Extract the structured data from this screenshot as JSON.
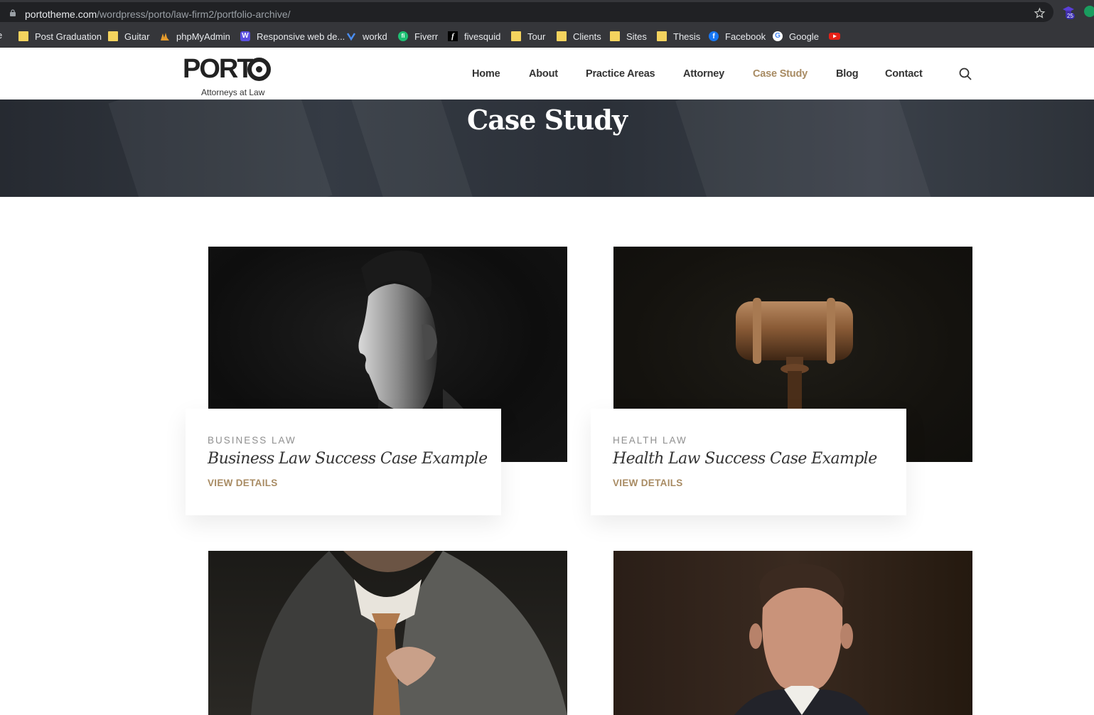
{
  "browser": {
    "url_host": "portotheme.com",
    "url_path": "/wordpress/porto/law-firm2/portfolio-archive/",
    "extension_badge": "25",
    "bookmarks": [
      {
        "label": "e",
        "icon": "truncated"
      },
      {
        "label": "Post Graduation",
        "icon": "folder-icon"
      },
      {
        "label": "Guitar",
        "icon": "folder-icon"
      },
      {
        "label": "phpMyAdmin",
        "icon": "phpmyadmin-icon"
      },
      {
        "label": "Responsive web de...",
        "icon": "w-icon"
      },
      {
        "label": "workd",
        "icon": "workd-icon"
      },
      {
        "label": "Fiverr",
        "icon": "fiverr-icon"
      },
      {
        "label": "fivesquid",
        "icon": "f-icon"
      },
      {
        "label": "Tour",
        "icon": "folder-icon"
      },
      {
        "label": "Clients",
        "icon": "folder-icon"
      },
      {
        "label": "Sites",
        "icon": "folder-icon"
      },
      {
        "label": "Thesis",
        "icon": "folder-icon"
      },
      {
        "label": "Facebook",
        "icon": "facebook-icon"
      },
      {
        "label": "Google",
        "icon": "google-icon"
      },
      {
        "label": "",
        "icon": "youtube-icon"
      }
    ]
  },
  "site": {
    "logo_text": "PORT",
    "logo_tagline": "Attorneys at Law",
    "nav": [
      "Home",
      "About",
      "Practice Areas",
      "Attorney",
      "Case Study",
      "Blog",
      "Contact"
    ],
    "active_nav": "Case Study",
    "accent_color": "#a88b63"
  },
  "hero": {
    "title": "Case Study"
  },
  "cards": [
    {
      "category": "BUSINESS LAW",
      "title": "Business Law Success Case Example",
      "link": "VIEW DETAILS",
      "image": "man-profile-photo"
    },
    {
      "category": "HEALTH LAW",
      "title": "Health Law Success Case Example",
      "link": "VIEW DETAILS",
      "image": "gavel-photo"
    },
    {
      "category": "",
      "title": "",
      "link": "",
      "image": "man-suit-tie-photo"
    },
    {
      "category": "",
      "title": "",
      "link": "",
      "image": "man-portrait-photo"
    }
  ]
}
